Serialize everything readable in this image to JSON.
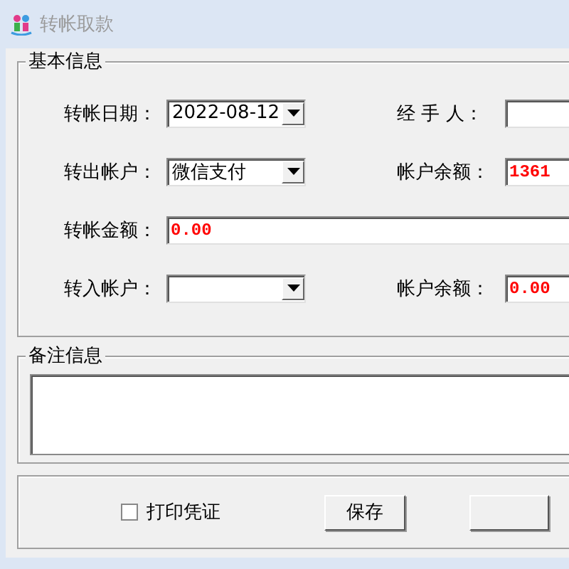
{
  "window": {
    "title": "转帐取款"
  },
  "basic_info": {
    "legend": "基本信息",
    "rows": [
      [
        {
          "kind": "dropdown",
          "label": "转帐日期：",
          "value": "2022-08-12"
        },
        {
          "kind": "text",
          "label": "经 手 人："
        }
      ],
      [
        {
          "kind": "dropdown",
          "label": "转出帐户：",
          "value": "微信支付"
        },
        {
          "kind": "amount",
          "label": "帐户余额：",
          "value": "1361"
        }
      ],
      [
        {
          "kind": "wide-amount",
          "label": "转帐金额：",
          "value": "0.00"
        }
      ],
      [
        {
          "kind": "dropdown",
          "label": "转入帐户："
        },
        {
          "kind": "amount",
          "label": "帐户余额：",
          "value": "0.00"
        }
      ]
    ]
  },
  "remarks": {
    "legend": "备注信息"
  },
  "footer": {
    "checkbox": {
      "label": "打印凭证",
      "checked": false
    },
    "buttons": [
      {
        "kind": "push",
        "label": "保存"
      },
      {
        "kind": "push"
      }
    ]
  }
}
